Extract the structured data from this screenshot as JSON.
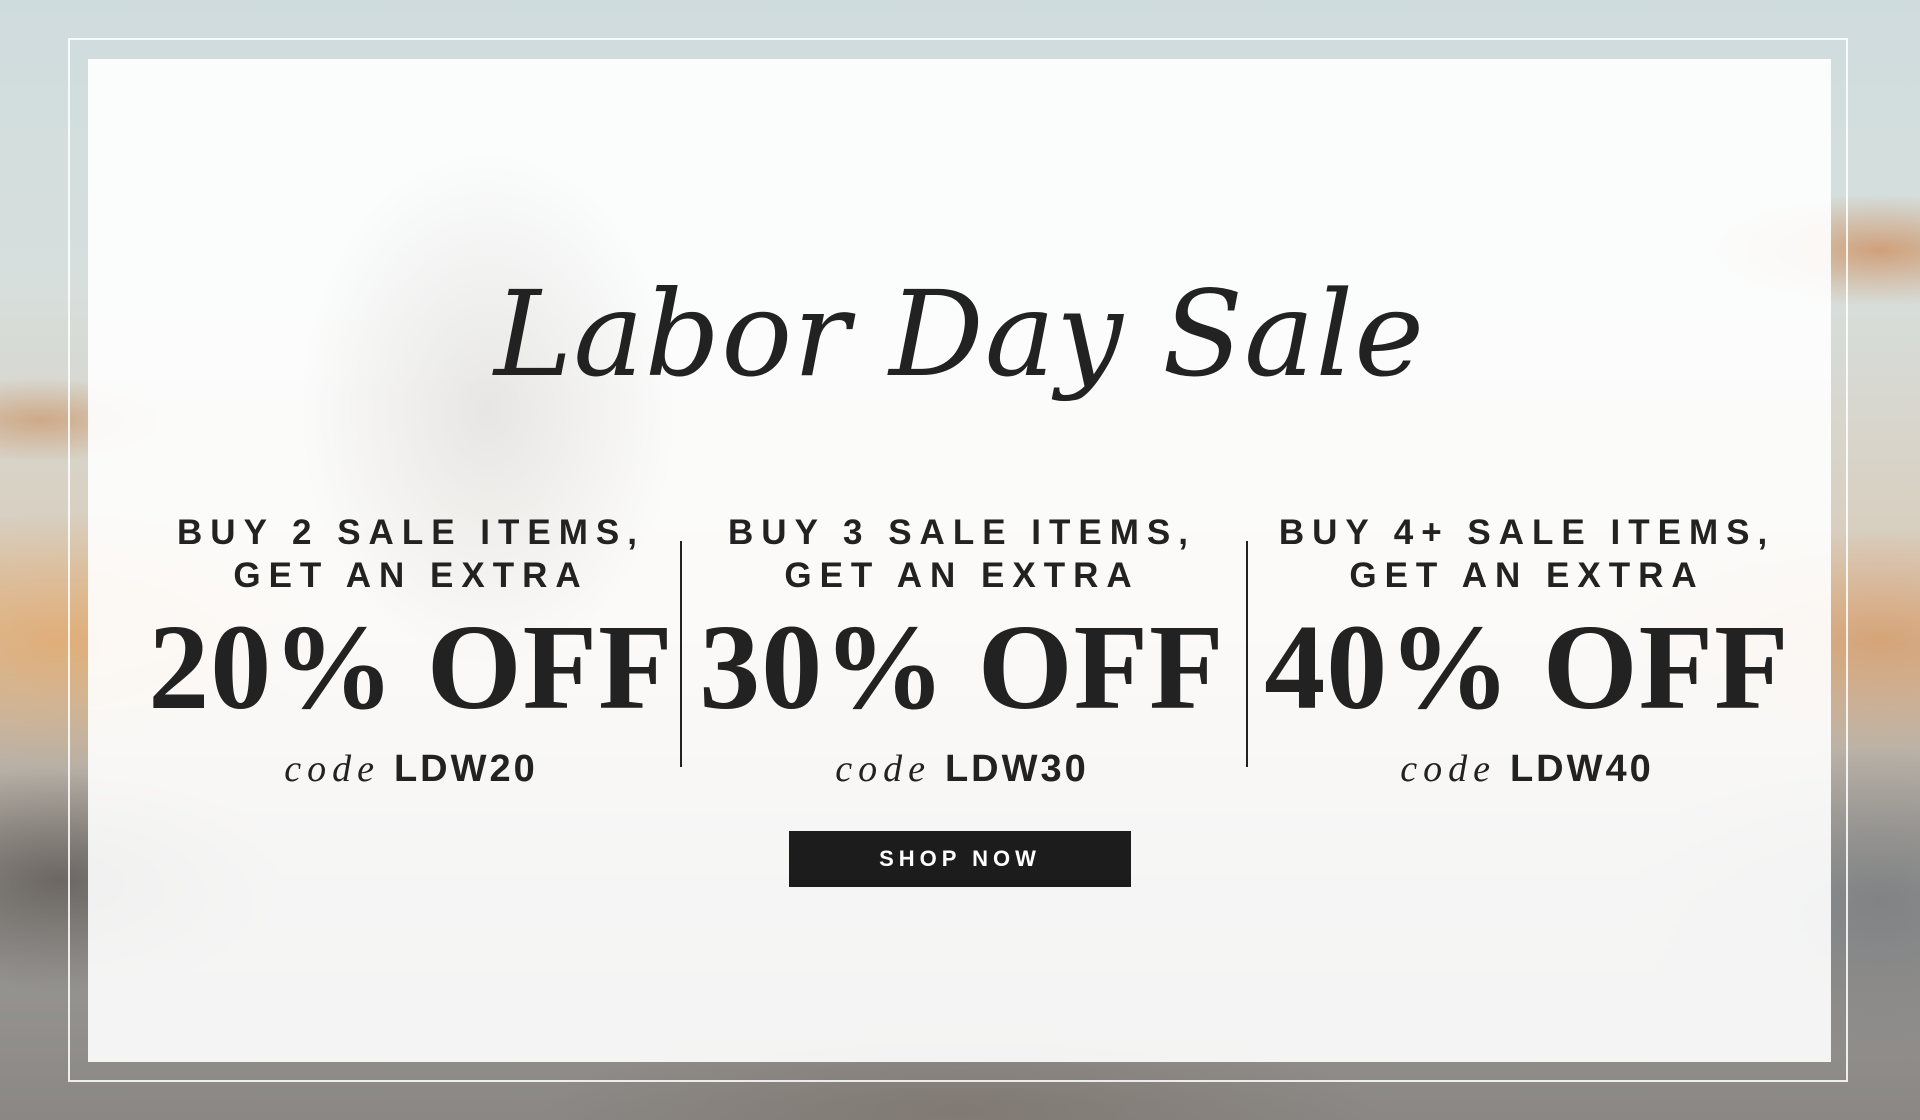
{
  "banner": {
    "title": "Labor Day Sale",
    "offers": [
      {
        "line1": "BUY 2 SALE ITEMS,",
        "line2": "GET AN EXTRA",
        "discount": "20% OFF",
        "code_label": "code",
        "code": "LDW20"
      },
      {
        "line1": "BUY 3 SALE ITEMS,",
        "line2": "GET AN EXTRA",
        "discount": "30% OFF",
        "code_label": "code",
        "code": "LDW30"
      },
      {
        "line1": "BUY 4+ SALE ITEMS,",
        "line2": "GET AN EXTRA",
        "discount": "40% OFF",
        "code_label": "code",
        "code": "LDW40"
      }
    ],
    "cta_label": "SHOP NOW"
  },
  "colors": {
    "text": "#222222",
    "button_bg": "#1c1c1c",
    "button_text": "#ffffff",
    "panel": "#ffffff"
  }
}
